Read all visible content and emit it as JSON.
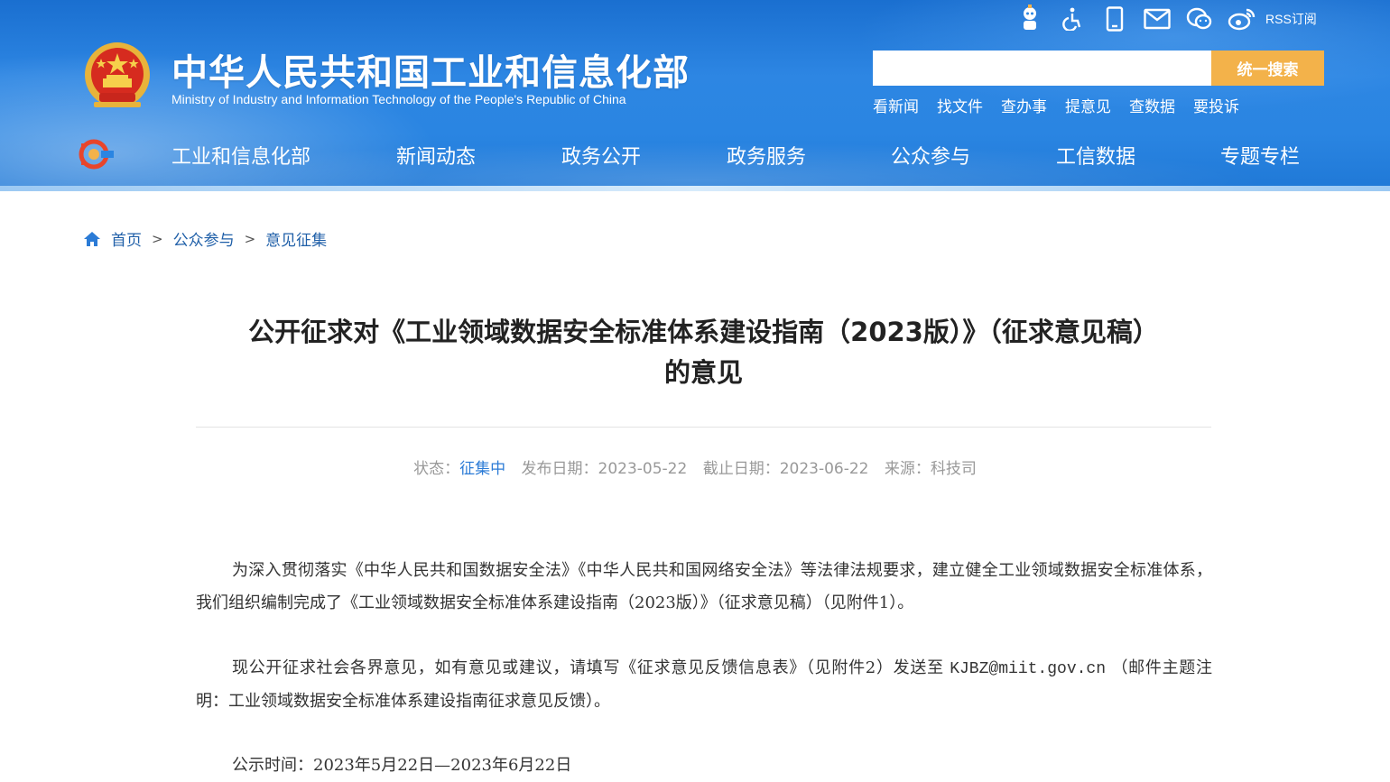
{
  "header": {
    "title": "中华人民共和国工业和信息化部",
    "subtitle": "Ministry of Industry and Information Technology of the People's Republic of China",
    "rss_label": "RSS订阅",
    "search": {
      "placeholder": "",
      "button_label": "统一搜索"
    },
    "quick_links": [
      "看新闻",
      "找文件",
      "查办事",
      "提意见",
      "查数据",
      "要投诉"
    ],
    "colors": {
      "header_blue": "#2a85e2",
      "search_button": "#f3b24a"
    }
  },
  "nav": {
    "items": [
      "工业和信息化部",
      "新闻动态",
      "政务公开",
      "政务服务",
      "公众参与",
      "工信数据",
      "专题专栏"
    ]
  },
  "breadcrumb": {
    "items": [
      "首页",
      "公众参与",
      "意见征集"
    ],
    "separator": ">"
  },
  "article": {
    "title_line1": "公开征求对《工业领域数据安全标准体系建设指南（2023版）》（征求意见稿）",
    "title_line2": "的意见",
    "meta": {
      "status_label": "状态：",
      "status_value": "征集中",
      "publish_label": "发布日期：",
      "publish_value": "2023-05-22",
      "deadline_label": "截止日期：",
      "deadline_value": "2023-06-22",
      "source_label": "来源：",
      "source_value": "科技司"
    },
    "paragraph1": "为深入贯彻落实《中华人民共和国数据安全法》《中华人民共和国网络安全法》等法律法规要求，建立健全工业领域数据安全标准体系，我们组织编制完成了《工业领域数据安全标准体系建设指南（2023版）》（征求意见稿）（见附件1）。",
    "paragraph2_before": "现公开征求社会各界意见，如有意见或建议，请填写《征求意见反馈信息表》（见附件2）发送至 ",
    "paragraph2_email": "KJBZ@miit.gov.cn",
    "paragraph2_after": " （邮件主题注明：工业领域数据安全标准体系建设指南征求意见反馈）。",
    "paragraph3": "公示时间：2023年5月22日—2023年6月22日"
  }
}
